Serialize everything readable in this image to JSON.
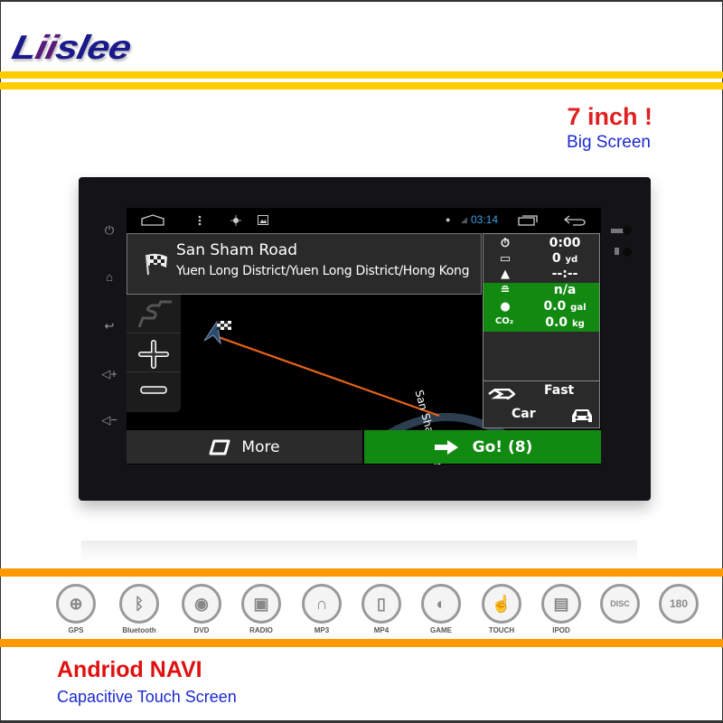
{
  "brand": {
    "logo_text": "Liislee",
    "logo_highlight": "ii"
  },
  "promo": {
    "title": "7 inch !",
    "subtitle": "Big Screen"
  },
  "device": {
    "side_buttons": [
      "power-icon",
      "home-icon",
      "back-icon",
      "volume-up-icon",
      "volume-down-icon"
    ],
    "side_glyphs": [
      "⏻",
      "⌂",
      "↩",
      "◁+",
      "◁−"
    ],
    "statusbar": {
      "home_icon": "home-outline-icon",
      "menu_icon": "overflow-menu-icon",
      "gps_icon": "gps-target-icon",
      "image_icon": "gallery-icon",
      "time": "03:14",
      "recents_icon": "recent-apps-icon",
      "back_icon": "back-arrow-icon"
    },
    "destination": {
      "name": "San Sham Road",
      "address": "Yuen Long District/Yuen Long District/Hong Kong"
    },
    "trip_info": {
      "time": "0:00",
      "distance": "0",
      "distance_unit": "yd",
      "eta": "--:--",
      "cost": "n/a",
      "fuel": "0.0",
      "fuel_unit": "gal",
      "co2_label": "CO₂",
      "co2": "0.0",
      "co2_unit": "kg",
      "route_mode": "Fast",
      "vehicle": "Car"
    },
    "map": {
      "street_label": "San Sham Road"
    },
    "buttons": {
      "more": "More",
      "go": "Go! (8)"
    }
  },
  "features": [
    {
      "label": "GPS",
      "glyph": "⊕"
    },
    {
      "label": "Bluetooth",
      "glyph": "ᛒ"
    },
    {
      "label": "DVD",
      "glyph": "◉"
    },
    {
      "label": "RADIO",
      "glyph": "▣"
    },
    {
      "label": "MP3",
      "glyph": "∩"
    },
    {
      "label": "MP4",
      "glyph": "▯"
    },
    {
      "label": "GAME",
      "glyph": "◐"
    },
    {
      "label": "TOUCH",
      "glyph": "☝"
    },
    {
      "label": "IPOD",
      "glyph": "▤"
    },
    {
      "label": "",
      "glyph": "DISC"
    },
    {
      "label": "",
      "glyph": "180"
    }
  ],
  "footer": {
    "title": "Andriod NAVI",
    "subtitle": "Capacitive Touch Screen"
  },
  "colors": {
    "brand_blue": "#1a1a8c",
    "promo_red": "#e02020",
    "nav_green": "#118a11",
    "route_orange": "#e8641a",
    "bar_yellow": "#ffcc00",
    "bar_orange": "#ff9900"
  }
}
